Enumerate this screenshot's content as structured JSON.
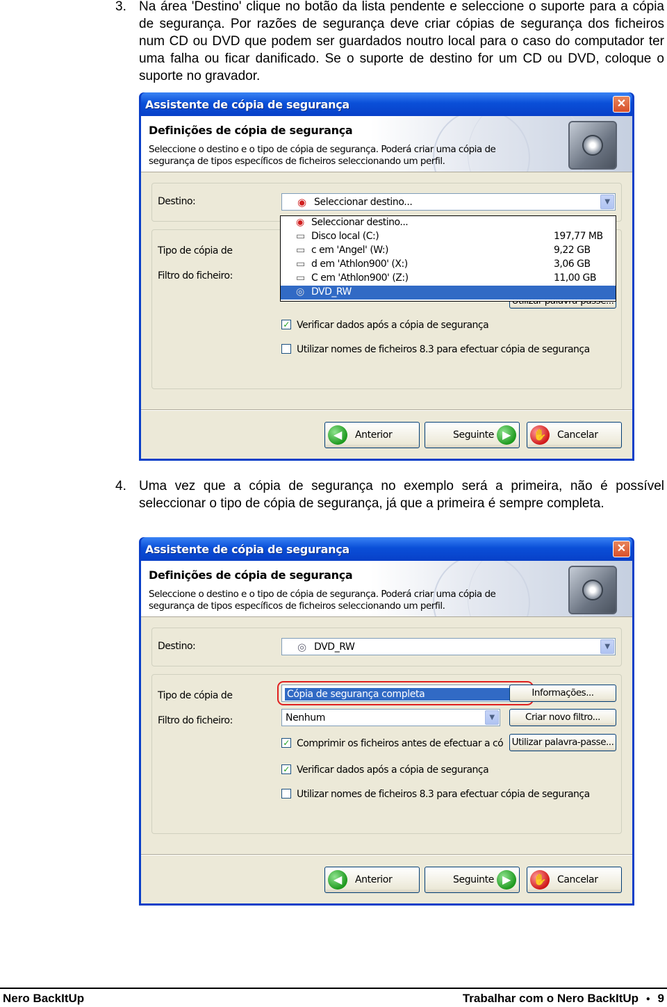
{
  "step3": {
    "num": "3.",
    "text": "Na área 'Destino' clique no botão da lista pendente e seleccione o suporte para a cópia de segurança. Por razões de segurança deve criar cópias de segurança dos ficheiros num CD ou DVD que podem ser guardados noutro local para o caso do computador ter uma falha ou ficar danificado. Se o suporte de destino for um CD ou DVD, coloque o suporte no gravador."
  },
  "step4": {
    "num": "4.",
    "text": "Uma vez que a cópia de segurança no exemplo será a primeira, não é possível seleccionar o tipo de cópia de segurança, já que a primeira é sempre completa."
  },
  "dialog": {
    "title": "Assistente de cópia de segurança",
    "close": "✕",
    "heading": "Definições de cópia de segurança",
    "description": "Seleccione o destino e o tipo de cópia de segurança. Poderá criar uma cópia de segurança de tipos específicos de ficheiros seleccionando um perfil.",
    "destino_label": "Destino:",
    "tipo_label": "Tipo de cópia de",
    "filtro_label": "Filtro do ficheiro:",
    "verify_label": "Verificar dados após a cópia de segurança",
    "names83_label": "Utilizar nomes de ficheiros 8.3 para efectuar cópia de segurança",
    "compress_label": "Comprimir os ficheiros antes de efectuar a cópia de",
    "btn_back": "Anterior",
    "btn_next": "Seguinte",
    "btn_cancel": "Cancelar",
    "btn_info": "Informações...",
    "btn_newfilter": "Criar novo filtro...",
    "btn_password": "Utilizar palavra-passe...",
    "check_mark": "✓"
  },
  "shot1": {
    "destino_value": "Seleccionar destino...",
    "dropdown_items": [
      {
        "label": "Seleccionar destino...",
        "size": "",
        "icon": "target-icon"
      },
      {
        "label": "Disco local (C:)",
        "size": "197,77 MB",
        "icon": "drive-icon"
      },
      {
        "label": "c em 'Angel' (W:)",
        "size": "9,22 GB",
        "icon": "network-drive-icon"
      },
      {
        "label": "d em 'Athlon900' (X:)",
        "size": "3,06 GB",
        "icon": "network-drive-icon"
      },
      {
        "label": "C em 'Athlon900' (Z:)",
        "size": "11,00 GB",
        "icon": "network-drive-icon"
      },
      {
        "label": "DVD_RW",
        "size": "",
        "icon": "dvd-drive-icon"
      }
    ]
  },
  "shot2": {
    "destino_value": "DVD_RW",
    "tipo_value": "Cópia de segurança completa",
    "filtro_value": "Nenhum"
  },
  "footer": {
    "left": "Nero BackItUp",
    "right": "Trabalhar com o Nero BackItUp",
    "bullet": "●",
    "page": "9"
  }
}
